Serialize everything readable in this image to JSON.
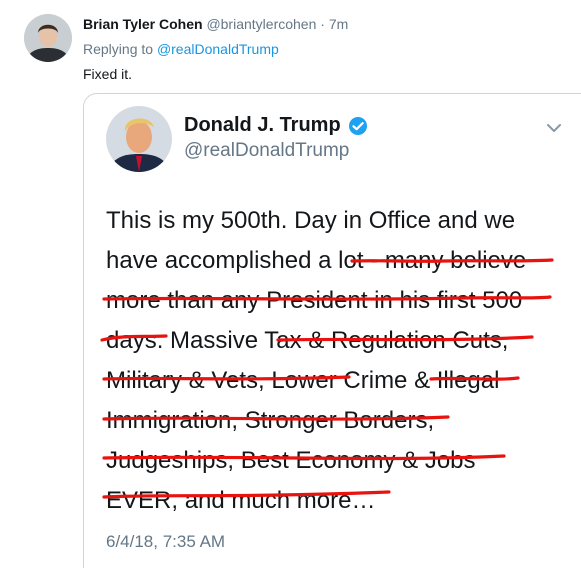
{
  "reply_tweet": {
    "author_name": "Brian Tyler Cohen",
    "author_handle": "@briantylercohen",
    "separator": "·",
    "time": "7m",
    "replying_prefix": "Replying to",
    "replying_to": "@realDonaldTrump",
    "text": "Fixed it."
  },
  "quoted_tweet": {
    "author_name": "Donald J. Trump",
    "author_handle": "@realDonaldTrump",
    "verified": true,
    "lines": [
      "This is my 500th. Day in Office and we",
      "have accomplished a lot - many believe",
      "more than any President in his first 500",
      "days. Massive Tax & Regulation Cuts,",
      "Military & Vets, Lower Crime & Illegal",
      "Immigration, Stronger Borders,",
      "Judgeships, Best Economy & Jobs",
      "EVER, and much more…"
    ],
    "timestamp": "6/4/18, 7:35 AM"
  },
  "icons": {
    "verified": "verified-badge-icon",
    "menu": "chevron-down-icon"
  },
  "colors": {
    "link": "#1b95e0",
    "muted": "#657786",
    "verified": "#1da1f2",
    "strike": "#e8130f"
  }
}
